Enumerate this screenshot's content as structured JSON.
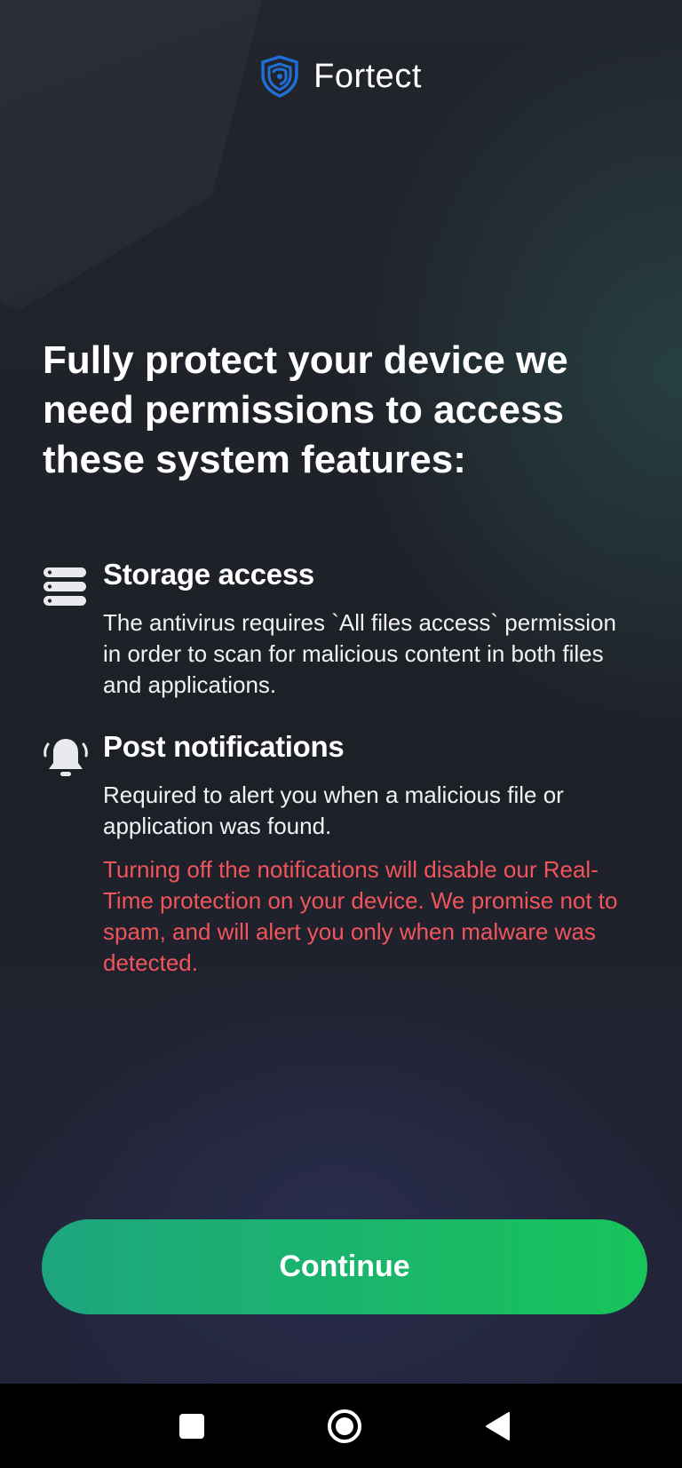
{
  "app": {
    "name": "Fortect"
  },
  "colors": {
    "accent": "#17c45a",
    "accent_start": "#1ea57f",
    "warning": "#f0555b",
    "background": "#1f2128",
    "logo_blue": "#1f6fd6"
  },
  "header": {
    "logo_icon": "shield-logo-icon"
  },
  "headline": "Fully protect your device we need permissions to access these system features:",
  "permissions": [
    {
      "icon": "storage-icon",
      "title": "Storage access",
      "description": "The antivirus requires `All files access` permission in order to scan for malicious content in both files and applications."
    },
    {
      "icon": "bell-icon",
      "title": "Post notifications",
      "description": "Required to alert you when a malicious file or application was found.",
      "warning": "Turning off the notifications will disable our Real-Time protection on your device. We promise not to spam, and will alert you only when malware was detected."
    }
  ],
  "actions": {
    "continue_label": "Continue"
  },
  "navbar": {
    "recents_icon": "square-icon",
    "home_icon": "circle-icon",
    "back_icon": "triangle-back-icon"
  }
}
